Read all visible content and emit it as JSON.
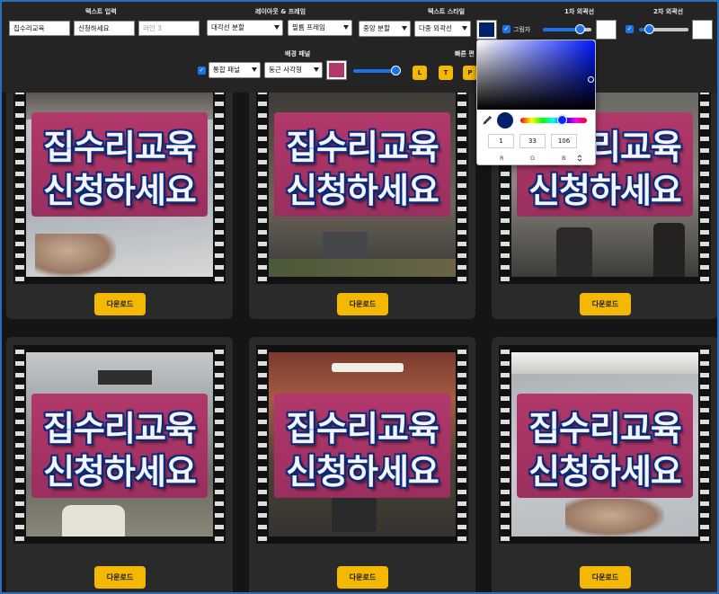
{
  "toolbar": {
    "text_input": {
      "label": "텍스트 입력",
      "line1_value": "집수리교육",
      "line2_value": "신청하세요",
      "line3_placeholder": "라인 3"
    },
    "layout": {
      "label": "레이아웃 & 프레임",
      "split_option": "대각선 분할",
      "frame_option": "필름 프레임"
    },
    "text_style": {
      "label": "텍스트 스타일",
      "align_option": "중앙 분할",
      "outline_option": "다중 외곽선",
      "text_color": "#01216a"
    },
    "shadow": {
      "label": "그림자",
      "checked": true
    },
    "outline1": {
      "label": "1차 외곽선",
      "checked": true,
      "color": "#ffffff",
      "level": 0.75
    },
    "outline2": {
      "label": "2차 외곽선",
      "checked": true,
      "color": "#ffffff",
      "level": 0.2
    },
    "bg_panel": {
      "label": "배경 패널",
      "checked": true,
      "panel_option": "통합 패널",
      "shape_option": "둥근 사각형",
      "color": "#b2386a",
      "level": 0.9
    },
    "quick": {
      "label": "빠른 편",
      "buttons": [
        "L",
        "T",
        "P"
      ]
    }
  },
  "color_picker": {
    "r": "1",
    "g": "33",
    "b": "106",
    "r_label": "R",
    "g_label": "G",
    "b_label": "B",
    "current_color": "#01216a",
    "hue_level": 0.62
  },
  "cards": [
    {
      "line1": "집수리교육",
      "line2": "신청하세요",
      "download_label": "다운로드"
    },
    {
      "line1": "집수리교육",
      "line2": "신청하세요",
      "download_label": "다운로드"
    },
    {
      "line1": "집수리교육",
      "line2": "신청하세요",
      "download_label": "다운로드"
    },
    {
      "line1": "집수리교육",
      "line2": "신청하세요",
      "download_label": "다운로드"
    },
    {
      "line1": "집수리교육",
      "line2": "신청하세요",
      "download_label": "다운로드"
    },
    {
      "line1": "집수리교육",
      "line2": "신청하세요",
      "download_label": "다운로드"
    }
  ]
}
